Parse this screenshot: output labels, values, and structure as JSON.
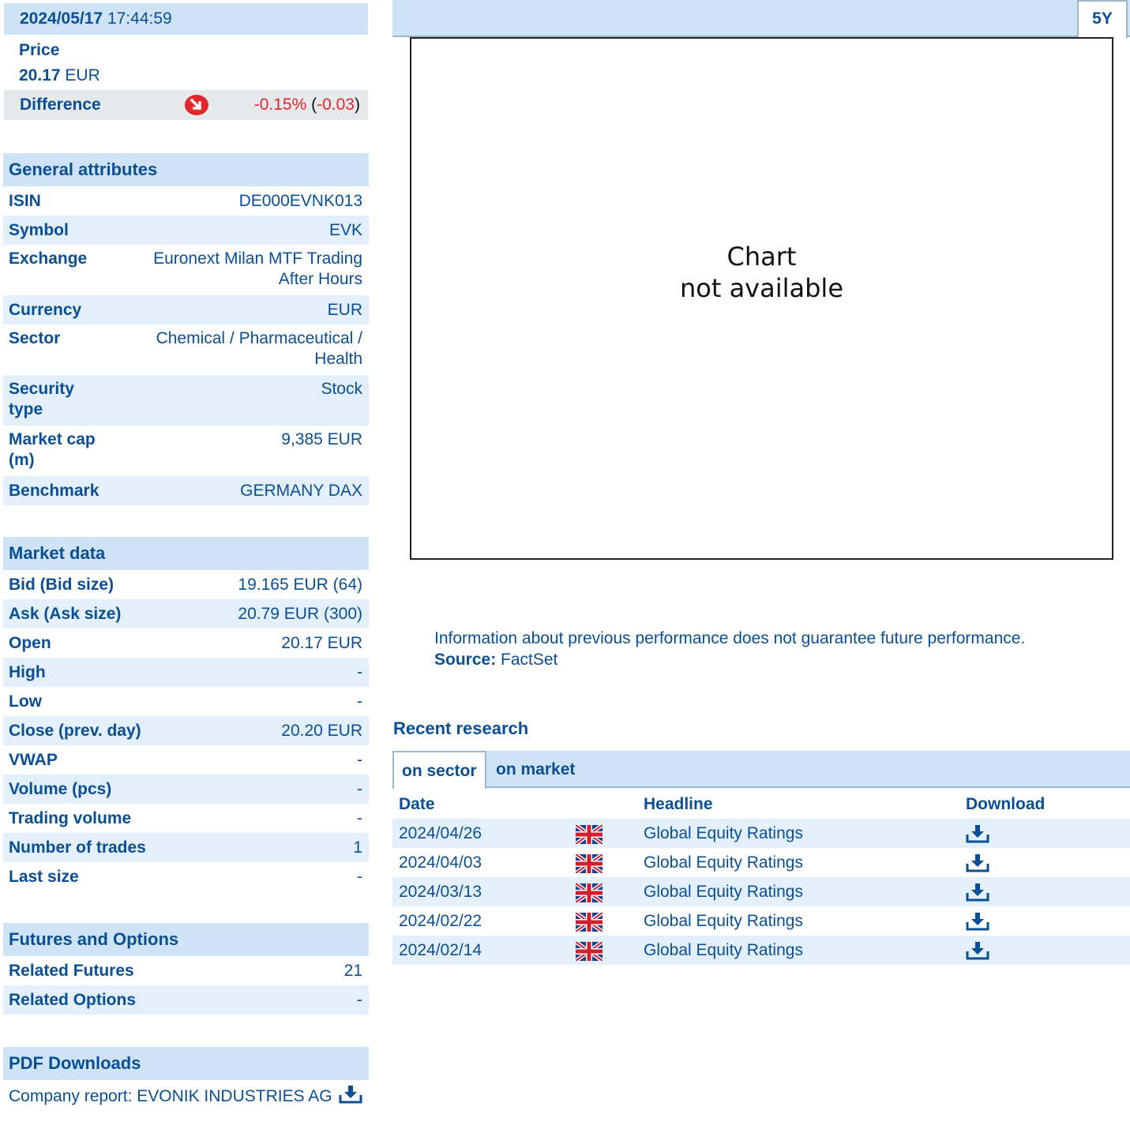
{
  "quote": {
    "date": "2024/05/17",
    "time": "17:44:59",
    "price_label": "Price",
    "price_value": "20.17",
    "price_currency": "EUR",
    "difference_label": "Difference",
    "difference_pct": "-0.15%",
    "difference_abs": "-0.03",
    "trend_icon": "arrow-down-circle-icon",
    "negative_color": "#e3262c"
  },
  "general": {
    "title": "General attributes",
    "rows": [
      {
        "label": "ISIN",
        "value": "DE000EVNK013"
      },
      {
        "label": "Symbol",
        "value": "EVK"
      },
      {
        "label": "Exchange",
        "value": "Euronext Milan MTF Trading After Hours"
      },
      {
        "label": "Currency",
        "value": "EUR"
      },
      {
        "label": "Sector",
        "value": "Chemical / Pharmaceutical / Health"
      },
      {
        "label": "Security type",
        "value": "Stock"
      },
      {
        "label": "Market cap (m)",
        "value": "9,385 EUR"
      },
      {
        "label": "Benchmark",
        "value": "GERMANY DAX"
      }
    ]
  },
  "market": {
    "title": "Market data",
    "rows": [
      {
        "label": "Bid (Bid size)",
        "value": "19.165 EUR (64)"
      },
      {
        "label": "Ask (Ask size)",
        "value": "20.79 EUR (300)"
      },
      {
        "label": "Open",
        "value": "20.17 EUR"
      },
      {
        "label": "High",
        "value": "-"
      },
      {
        "label": "Low",
        "value": "-"
      },
      {
        "label": "Close (prev. day)",
        "value": "20.20 EUR"
      },
      {
        "label": "VWAP",
        "value": "-"
      },
      {
        "label": "Volume (pcs)",
        "value": "-"
      },
      {
        "label": "Trading volume",
        "value": "-"
      },
      {
        "label": "Number of trades",
        "value": "1"
      },
      {
        "label": "Last size",
        "value": "-"
      }
    ]
  },
  "futures": {
    "title": "Futures and Options",
    "rows": [
      {
        "label": "Related Futures",
        "value": "21"
      },
      {
        "label": "Related Options",
        "value": "-"
      }
    ]
  },
  "pdf": {
    "title": "PDF Downloads",
    "item": "Company report: EVONIK INDUSTRIES AG",
    "icon": "download-icon"
  },
  "chart": {
    "tab_label": "5Y",
    "message_line1": "Chart",
    "message_line2": "not available"
  },
  "disclaimer": {
    "text": "Information about previous performance does not guarantee future performance.",
    "source_label": "Source:",
    "source_value": "FactSet"
  },
  "research": {
    "title": "Recent research",
    "tabs": [
      "on sector",
      "on market"
    ],
    "columns": {
      "date": "Date",
      "headline": "Headline",
      "download": "Download"
    },
    "rows": [
      {
        "date": "2024/04/26",
        "headline": "Global Equity Ratings"
      },
      {
        "date": "2024/04/03",
        "headline": "Global Equity Ratings"
      },
      {
        "date": "2024/03/13",
        "headline": "Global Equity Ratings"
      },
      {
        "date": "2024/02/22",
        "headline": "Global Equity Ratings"
      },
      {
        "date": "2024/02/14",
        "headline": "Global Equity Ratings"
      }
    ],
    "flag_icon": "uk-flag-icon",
    "download_icon": "download-icon"
  }
}
